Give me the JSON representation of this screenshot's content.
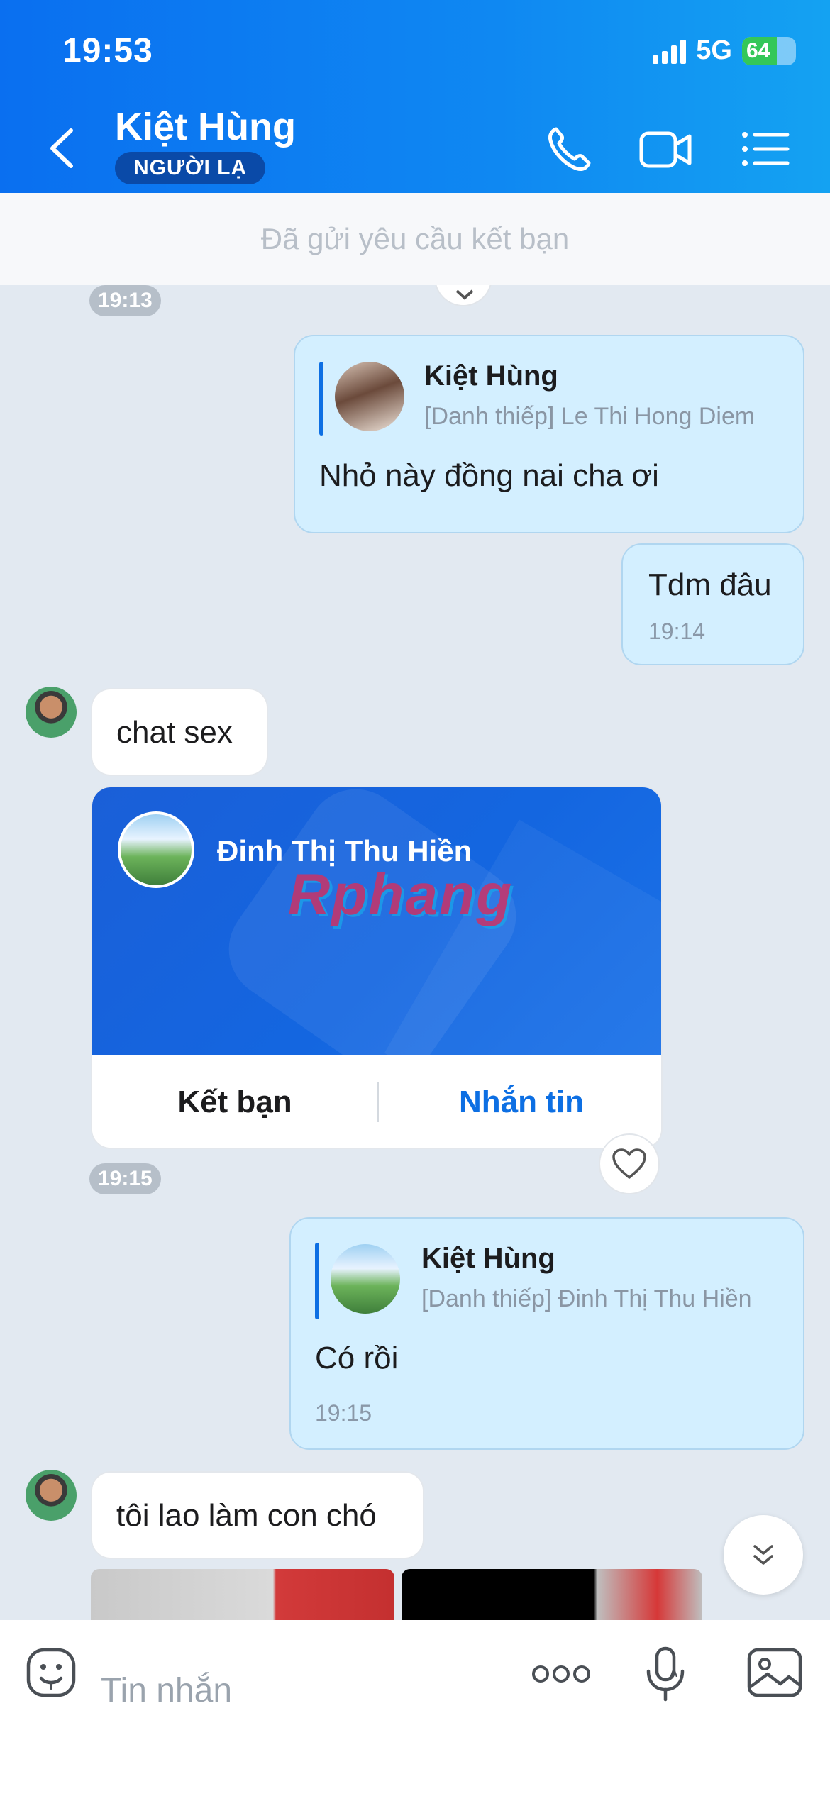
{
  "status_bar": {
    "time": "19:53",
    "network": "5G",
    "battery": "64",
    "battery_level": 0.64
  },
  "header": {
    "contact_name": "Kiệt Hùng",
    "badge": "NGƯỜI LẠ"
  },
  "friend_request_banner": "Đã gửi yêu cầu kết bạn",
  "messages": {
    "time_1": "19:13",
    "quote_1": {
      "name": "Kiệt Hùng",
      "sub": "[Danh thiếp] Le Thi Hong Diem",
      "text": "Nhỏ này đồng nai cha ơi"
    },
    "out_2": {
      "text": "Tdm đâu",
      "time": "19:14"
    },
    "in_1": {
      "text": "chat sex"
    },
    "card": {
      "name": "Đinh Thị Thu Hiền",
      "watermark": "Rphang",
      "add_friend": "Kết bạn",
      "message": "Nhắn tin"
    },
    "time_2": "19:15",
    "quote_2": {
      "name": "Kiệt Hùng",
      "sub": "[Danh thiếp] Đinh Thị Thu Hiền",
      "text": "Có rồi",
      "time": "19:15"
    },
    "in_2": {
      "text": "tôi lao làm con chó"
    }
  },
  "input": {
    "placeholder": "Tin nhắn"
  },
  "colors": {
    "header": "#0f88f2",
    "out_bubble": "#d3efff",
    "accent": "#0d6fe3",
    "background": "#e2e9f1"
  },
  "icons": [
    "back-icon",
    "phone-icon",
    "video-icon",
    "menu-icon",
    "heart-icon",
    "chevron-down-icon",
    "sticker-icon",
    "more-icon",
    "mic-icon",
    "image-icon"
  ]
}
